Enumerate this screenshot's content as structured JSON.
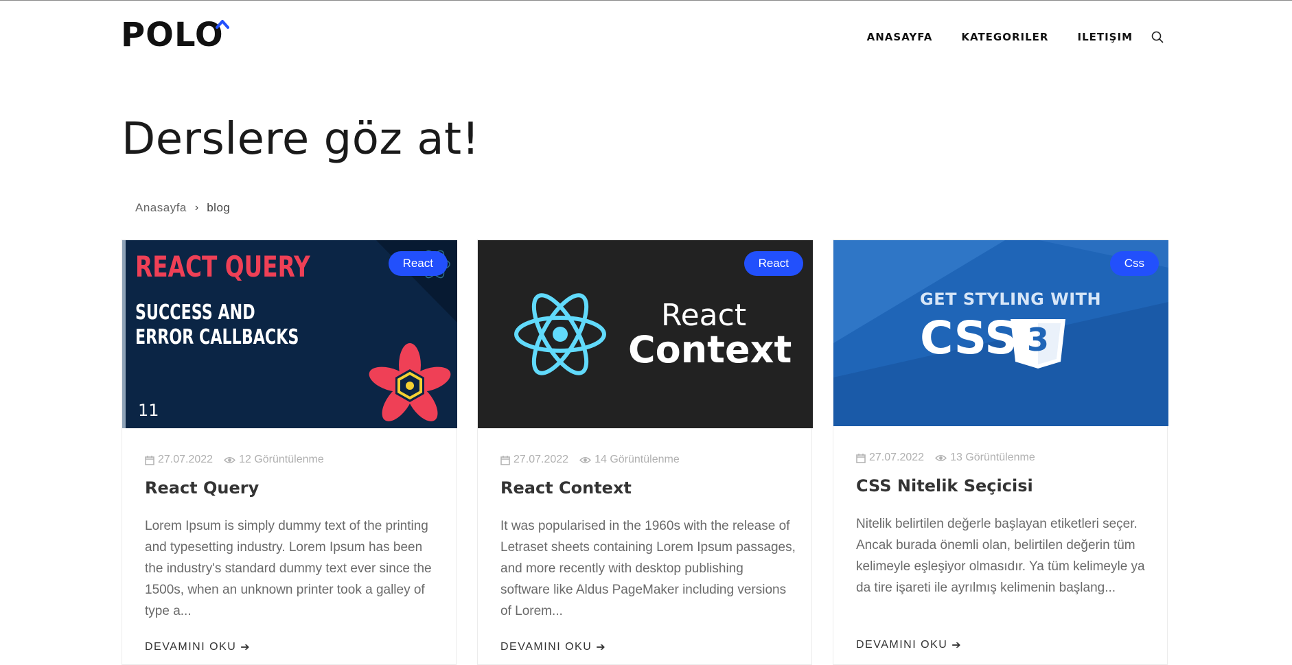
{
  "brand": {
    "logo_text": "POLO"
  },
  "nav": {
    "items": [
      "ANASAYFA",
      "KATEGORILER",
      "ILETIŞIM"
    ],
    "search_icon": "search-icon"
  },
  "page": {
    "title": "Derslere göz at!"
  },
  "breadcrumb": {
    "home": "Anasayfa",
    "separator": "›",
    "current": "blog"
  },
  "colors": {
    "accent": "#2250fc",
    "text": "#222222",
    "muted": "#b0b0b0"
  },
  "cards": [
    {
      "badge": "React",
      "image": {
        "line1": "REACT QUERY",
        "line2": "SUCCESS AND",
        "line3": "ERROR CALLBACKS",
        "number": "11"
      },
      "date": "27.07.2022",
      "views": "12 Görüntülenme",
      "title": "React Query",
      "excerpt": "Lorem Ipsum is simply dummy text of the printing and typesetting industry. Lorem Ipsum has been the industry's standard dummy text ever since the 1500s, when an unknown printer took a galley of type a...",
      "read_more": "DEVAMINI OKU"
    },
    {
      "badge": "React",
      "image": {
        "line1": "React",
        "line2": "Context"
      },
      "date": "27.07.2022",
      "views": "14 Görüntülenme",
      "title": "React Context",
      "excerpt": "It was popularised in the 1960s with the release of Letraset sheets containing Lorem Ipsum passages, and more recently with desktop publishing software like Aldus PageMaker including versions of Lorem...",
      "read_more": "DEVAMINI OKU"
    },
    {
      "badge": "Css",
      "image": {
        "line1": "GET STYLING WITH",
        "line2": "CSS",
        "shield": "3"
      },
      "date": "27.07.2022",
      "views": "13 Görüntülenme",
      "title": "CSS Nitelik Seçicisi",
      "excerpt": "Nitelik belirtilen değerle başlayan etiketleri seçer. Ancak burada önemli olan, belirtilen değerin tüm kelimeyle eşleşiyor olmasıdır. Ya tüm kelimeyle ya da tire işareti ile ayrılmış kelimenin başlang...",
      "read_more": "DEVAMINI OKU"
    }
  ]
}
